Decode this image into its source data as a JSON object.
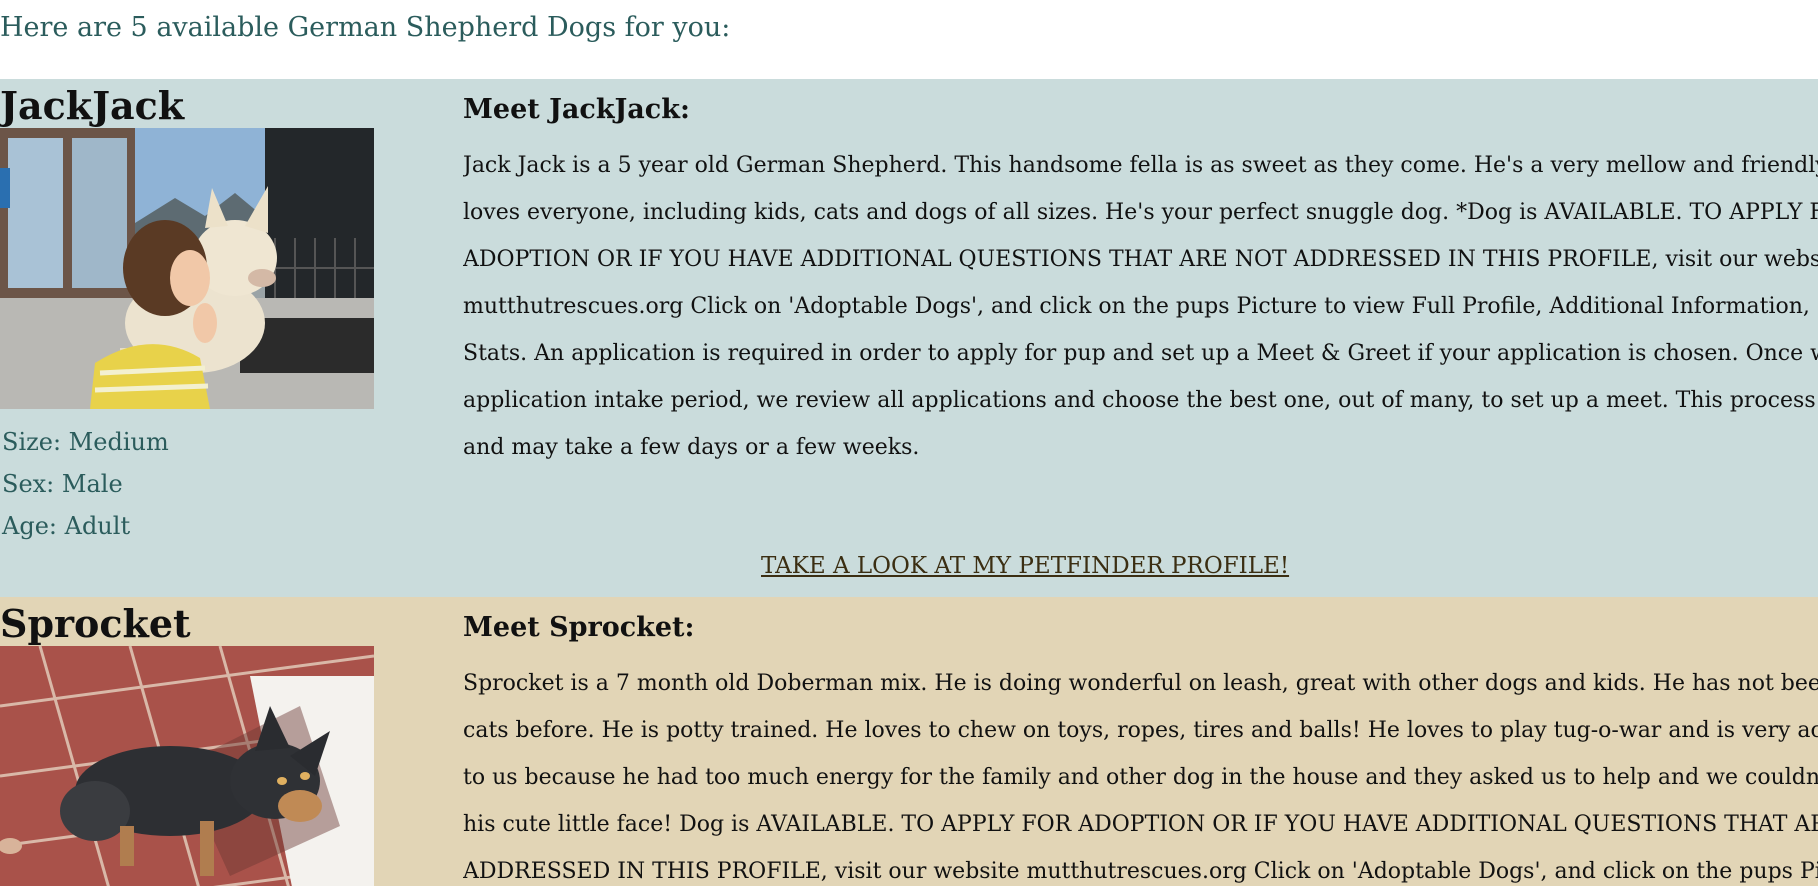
{
  "intro": "Here are 5 available German Shepherd Dogs for you:",
  "dogs": [
    {
      "name": "JackJack",
      "meet": "Meet JackJack:",
      "size": "Size: Medium",
      "sex": "Sex: Male",
      "age": "Age: Adult",
      "description_lines": [
        "Jack Jack is a 5 year old German Shepherd. This handsome fella is as sweet as they come. He's a very mellow and friendly fella",
        "loves everyone, including kids, cats and dogs of all sizes. He's your perfect snuggle dog. *Dog is AVAILABLE. TO APPLY FOR",
        "ADOPTION OR IF YOU HAVE ADDITIONAL QUESTIONS THAT ARE NOT ADDRESSED IN THIS PROFILE, visit our website",
        "mutthutrescues.org Click on 'Adoptable Dogs', and click on the pups Picture to view Full Profile, Additional Information, Pictur",
        "Stats. An application is required in order to apply for pup and set up a Meet & Greet if your application is chosen. Once we clos",
        "application intake period, we review all applications and choose the best one, out of many, to set up a meet. This process is len",
        "and may take a few days or a few weeks."
      ],
      "profile_link": "TAKE A LOOK AT MY PETFINDER PROFILE!"
    },
    {
      "name": "Sprocket",
      "meet": "Meet Sprocket:",
      "description_lines": [
        "Sprocket is a 7 month old Doberman mix. He is doing wonderful on leash, great with other dogs and kids. He has not been aro",
        "cats before. He is potty trained. He loves to chew on toys, ropes, tires and balls! He loves to play tug-o-war and is very active. H",
        "to us because he had too much energy for the family and other dog in the house and they asked us to help and we couldn't say",
        "his cute little face! Dog is AVAILABLE. TO APPLY FOR ADOPTION OR IF YOU HAVE ADDITIONAL QUESTIONS THAT ARE N",
        "ADDRESSED IN THIS PROFILE, visit our website mutthutrescues.org Click on 'Adoptable Dogs', and click on the pups Picture"
      ]
    }
  ],
  "colors": {
    "intro_text": "#2b5c5c",
    "dog1_bg": "#cadcdc",
    "dog2_bg": "#e2d5b6",
    "link": "#3b2e12"
  }
}
